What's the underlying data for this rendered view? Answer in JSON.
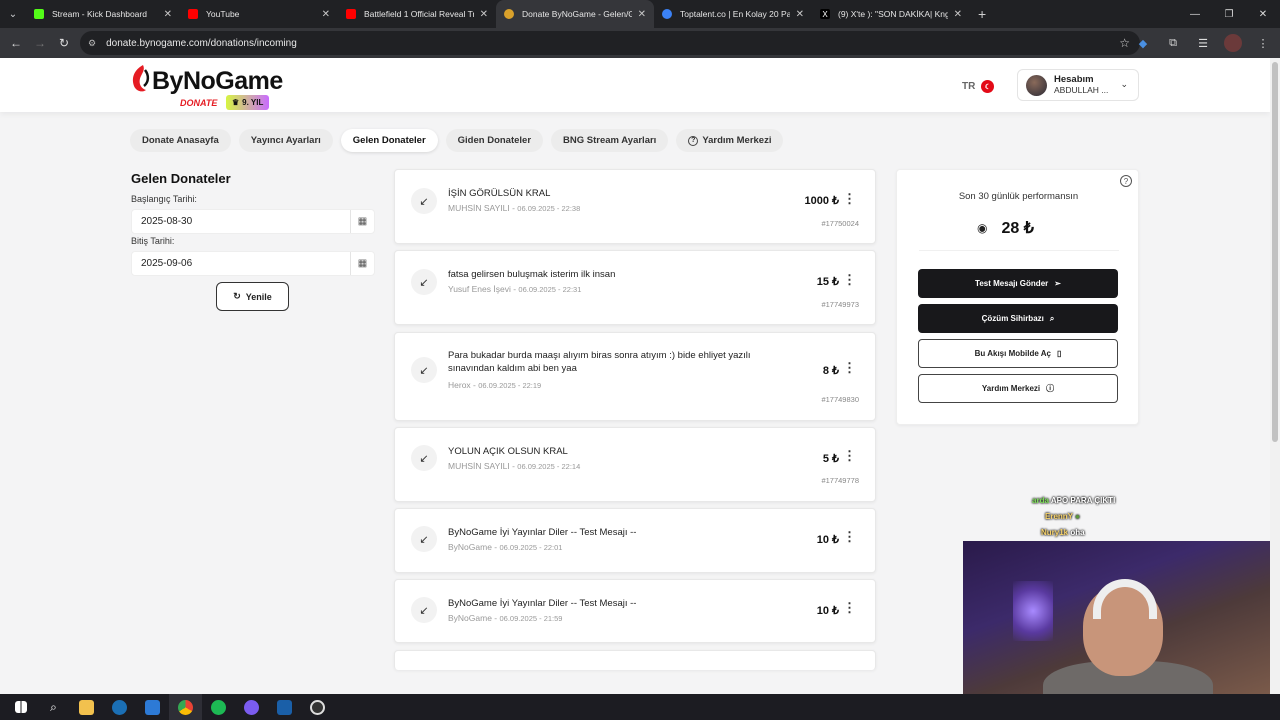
{
  "browser": {
    "tabs": [
      {
        "title": "Stream - Kick Dashboard",
        "color": "#53fc18"
      },
      {
        "title": "YouTube",
        "color": "#ff0000"
      },
      {
        "title": "Battlefield 1 Official Reveal Trai",
        "color": "#ff0000"
      },
      {
        "title": "Donate ByNoGame - Gelen/Gid",
        "color": "#d9a12b"
      },
      {
        "title": "Toptalent.co | En Kolay 20 Para",
        "color": "#3b82f6"
      },
      {
        "title": "(9) X'te ): \"SON DAKİKA| Kngl S",
        "color": "#000000"
      }
    ],
    "url": "donate.bynogame.com/donations/incoming"
  },
  "header": {
    "brand": "ByNoGame",
    "sub": "DONATE",
    "badge": "9. YIL",
    "lang": "TR",
    "account_title": "Hesabım",
    "account_name": "ABDULLAH ..."
  },
  "nav": [
    {
      "label": "Donate Anasayfa"
    },
    {
      "label": "Yayıncı Ayarları"
    },
    {
      "label": "Gelen Donateler"
    },
    {
      "label": "Giden Donateler"
    },
    {
      "label": "BNG Stream Ayarları"
    },
    {
      "label": "Yardım Merkezi"
    }
  ],
  "filters": {
    "title": "Gelen Donateler",
    "start_label": "Başlangıç Tarihi:",
    "start_value": "2025-08-30",
    "end_label": "Bitiş Tarihi:",
    "end_value": "2025-09-06",
    "refresh": "Yenile"
  },
  "donations": [
    {
      "message": "İŞİN GÖRÜLSÜN KRAL",
      "sender": "MUHSİN SAYILI",
      "date": "06.09.2025 - 22:38",
      "amount": "1000 ₺",
      "id": "#17750024"
    },
    {
      "message": "fatsa gelirsen buluşmak isterim ilk insan",
      "sender": "Yusuf Enes İşevi",
      "date": "06.09.2025 - 22:31",
      "amount": "15 ₺",
      "id": "#17749973"
    },
    {
      "message": "Para bukadar burda maaşı alıyım biras sonra atıyım :) bide ehliyet yazılı sınavından kaldım abi ben yaa",
      "sender": "Herox",
      "date": "06.09.2025 - 22:19",
      "amount": "8 ₺",
      "id": "#17749830"
    },
    {
      "message": "YOLUN AÇIK OLSUN KRAL",
      "sender": "MUHSİN SAYILI",
      "date": "06.09.2025 - 22:14",
      "amount": "5 ₺",
      "id": "#17749778"
    },
    {
      "message": "ByNoGame İyi Yayınlar Diler -- Test Mesajı --",
      "sender": "ByNoGame",
      "date": "06.09.2025 - 22:01",
      "amount": "10 ₺",
      "id": ""
    },
    {
      "message": "ByNoGame İyi Yayınlar Diler -- Test Mesajı --",
      "sender": "ByNoGame",
      "date": "06.09.2025 - 21:59",
      "amount": "10 ₺",
      "id": ""
    }
  ],
  "performance": {
    "title": "Son 30 günlük performansın",
    "value": "28 ₺",
    "buttons": [
      {
        "label": "Test Mesajı Gönder",
        "icon": "send-icon"
      },
      {
        "label": "Çözüm Sihirbazı",
        "icon": "magic-search-icon"
      },
      {
        "label": "Bu Akışı Mobilde Aç",
        "icon": "phone-icon"
      },
      {
        "label": "Yardım Merkezi",
        "icon": "help-icon"
      }
    ]
  },
  "chat_overlay": [
    {
      "user": "arda",
      "text": "APO PARA ÇIKTI"
    },
    {
      "user": "ErennY",
      "text": ""
    },
    {
      "user": "Nury1k",
      "text": "oha"
    }
  ]
}
